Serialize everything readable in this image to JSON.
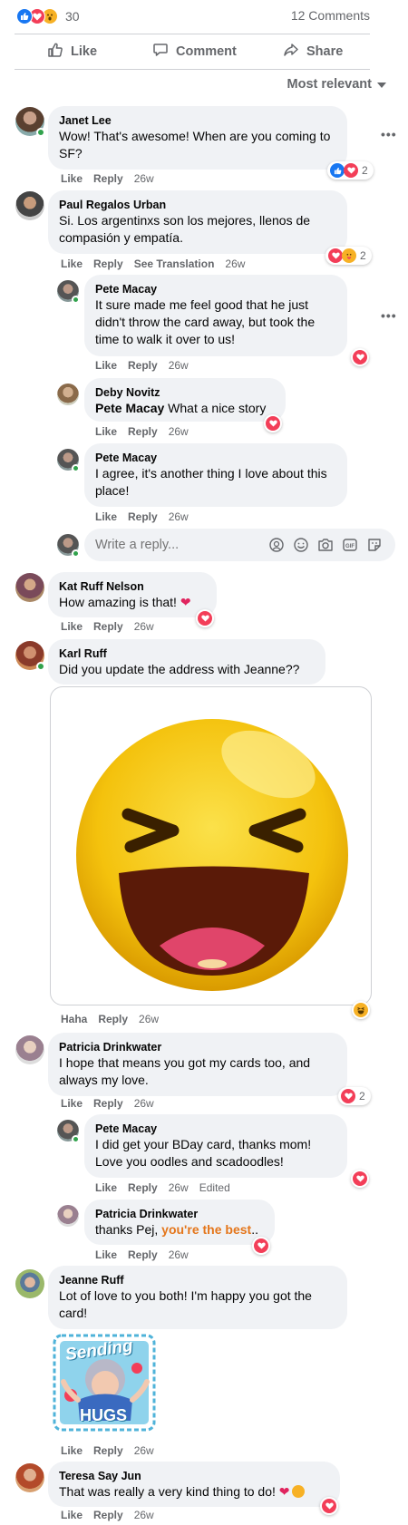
{
  "summary": {
    "reaction_count": "30",
    "comment_count": "12 Comments"
  },
  "actions": {
    "like": "Like",
    "comment": "Comment",
    "share": "Share"
  },
  "sort": {
    "label": "Most relevant"
  },
  "labels": {
    "like": "Like",
    "reply": "Reply",
    "haha": "Haha",
    "see_translation": "See Translation",
    "edited": "Edited",
    "more": "..."
  },
  "reply_box": {
    "placeholder": "Write a reply..."
  },
  "comments": [
    {
      "author": "Janet Lee",
      "text": "Wow! That's awesome! When are you coming to SF?",
      "time": "26w",
      "reactions": "2"
    },
    {
      "author": "Paul Regalos Urban",
      "text": "Si. Los argentinxs son los mejores, llenos de compasión y empatía.",
      "time": "26w",
      "reactions": "2"
    },
    {
      "author": "Pete Macay",
      "text": "It sure made me feel good that he just didn't throw the card away, but took the time to walk it over to us!",
      "time": "26w"
    },
    {
      "author": "Deby Novitz",
      "mention": "Pete Macay",
      "text": " What a nice story",
      "time": "26w"
    },
    {
      "author": "Pete Macay",
      "text": "I agree, it's another thing I love about this place!",
      "time": "26w"
    },
    {
      "author": "Kat Ruff Nelson",
      "text": "How amazing is that!",
      "time": "26w"
    },
    {
      "author": "Karl Ruff",
      "text": "Did you update the address with Jeanne??",
      "time": "26w"
    },
    {
      "author": "Patricia Drinkwater",
      "text": "I hope that means you got my cards too, and always my love.",
      "time": "26w",
      "reactions": "2"
    },
    {
      "author": "Pete Macay",
      "text": "I did get your BDay card, thanks mom! Love you oodles and scadoodles!",
      "time": "26w"
    },
    {
      "author": "Patricia Drinkwater",
      "text": "thanks Pej, ",
      "highlight": "you're the best",
      "text_end": "..",
      "time": "26w"
    },
    {
      "author": "Jeanne Ruff",
      "text": "Lot of love to you both! I'm happy you got the card!",
      "time": "26w"
    },
    {
      "author": "Teresa Say Jun",
      "text": "That was really a very kind thing to do!",
      "time": "26w"
    }
  ],
  "sticker": {
    "line1": "Sending",
    "line2": "HUGS"
  },
  "colors": {
    "accent": "#1877f2",
    "love": "#f33e58",
    "highlight": "#e4761b",
    "bubble": "#f0f2f5",
    "meta": "#65676b"
  }
}
